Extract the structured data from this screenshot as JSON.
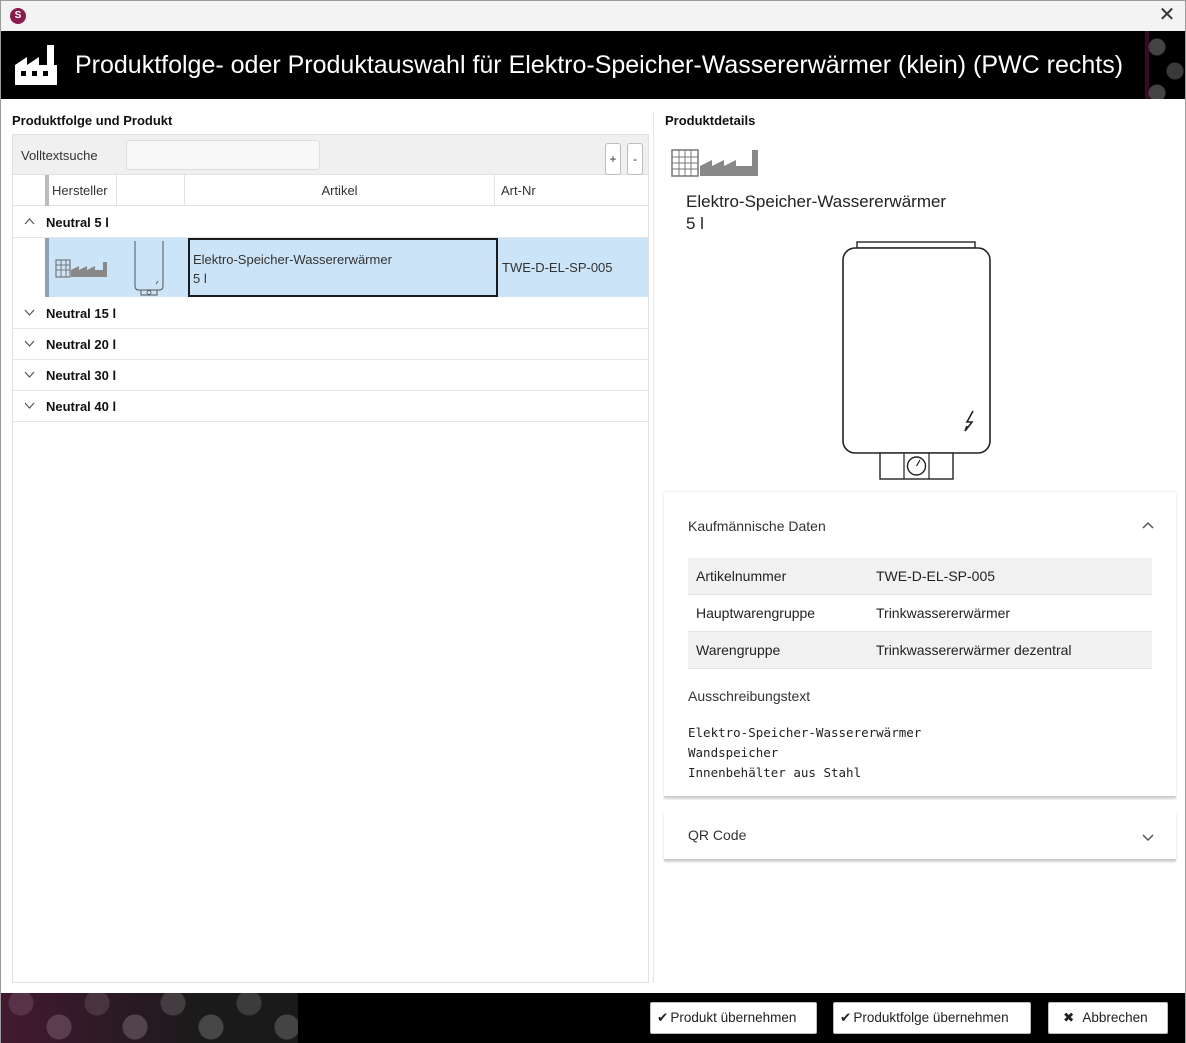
{
  "window": {
    "app_icon_letter": "S",
    "close_glyph": "✕"
  },
  "header": {
    "title": "Produktfolge- oder Produktauswahl für Elektro-Speicher-Wassererwärmer (klein) (PWC rechts)",
    "icon": "factory-icon"
  },
  "left": {
    "section_title": "Produktfolge und Produkt",
    "search_label": "Volltextsuche",
    "search_value": "",
    "expand_label": "+",
    "collapse_label": "-",
    "columns": [
      "Hersteller",
      "",
      "Artikel",
      "Art-Nr"
    ],
    "groups": [
      {
        "label": "Neutral 5 l",
        "expanded": true
      },
      {
        "label": "Neutral 15 l",
        "expanded": false
      },
      {
        "label": "Neutral 20 l",
        "expanded": false
      },
      {
        "label": "Neutral 30 l",
        "expanded": false
      },
      {
        "label": "Neutral 40 l",
        "expanded": false
      }
    ],
    "row": {
      "article_line1": "Elektro-Speicher-Wassererwärmer",
      "article_line2": "5 l",
      "art_nr": "TWE-D-EL-SP-005"
    }
  },
  "right": {
    "section_title": "Produktdetails",
    "product_name_line1": "Elektro-Speicher-Wassererwärmer",
    "product_name_line2": "5 l",
    "commercial": {
      "title": "Kaufmännische Daten",
      "rows": [
        {
          "key": "Artikelnummer",
          "value": "TWE-D-EL-SP-005"
        },
        {
          "key": "Hauptwarengruppe",
          "value": "Trinkwassererwärmer"
        },
        {
          "key": "Warengruppe",
          "value": "Trinkwassererwärmer dezentral"
        }
      ],
      "spec_label": "Ausschreibungstext",
      "spec_text": "Elektro-Speicher-Wassererwärmer\nWandspeicher\nInnenbehälter aus Stahl"
    },
    "qr": {
      "title": "QR Code"
    }
  },
  "footer": {
    "buttons": {
      "take_product": "Produkt übernehmen",
      "take_series": "Produktfolge übernehmen",
      "cancel": "Abbrechen"
    }
  },
  "colors": {
    "selection": "#cce4f7",
    "brand": "#8a1c4d",
    "header_bg": "#000000"
  }
}
